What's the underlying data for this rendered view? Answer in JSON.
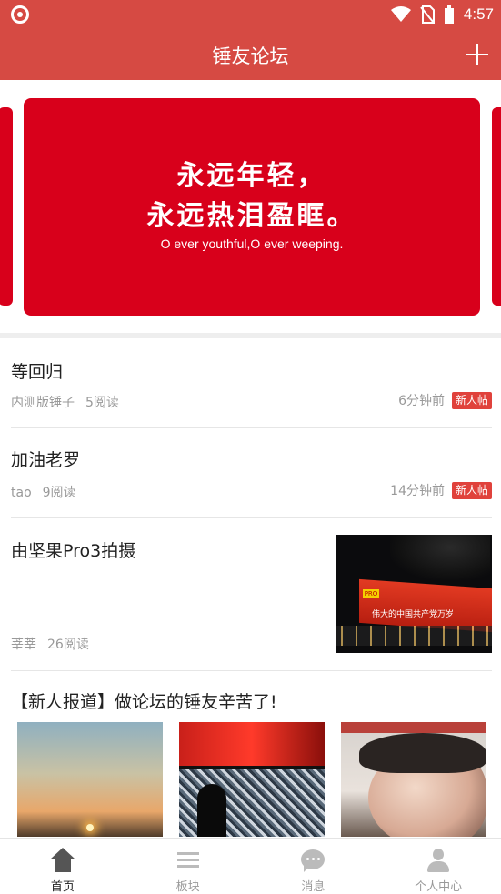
{
  "status_bar": {
    "time": "4:57",
    "icons": [
      "app-circle-icon",
      "wifi-icon",
      "no-sim-icon",
      "battery-icon"
    ]
  },
  "header": {
    "title": "锤友论坛",
    "add_icon": "plus-icon"
  },
  "banner": {
    "line1": "永远年轻，",
    "line2": "永远热泪盈眶。",
    "subtitle": "O ever youthful,O ever weeping."
  },
  "posts": [
    {
      "title": "等回归",
      "author": "内测版锤子",
      "reads": "5阅读",
      "time": "6分钟前",
      "badge": "新人帖"
    },
    {
      "title": "加油老罗",
      "author": "tao",
      "reads": "9阅读",
      "time": "14分钟前",
      "badge": "新人帖"
    },
    {
      "title": "由坚果Pro3拍摄",
      "author": "莘莘",
      "reads": "26阅读",
      "image_caption": "伟大的中国共产党万岁",
      "image_logo": "PRO"
    }
  ],
  "announcement": {
    "title": "【新人报道】做论坛的锤友辛苦了!"
  },
  "bottom_nav": {
    "items": [
      {
        "label": "首页",
        "icon": "home-icon",
        "active": true
      },
      {
        "label": "板块",
        "icon": "menu-icon",
        "active": false
      },
      {
        "label": "消息",
        "icon": "chat-icon",
        "active": false
      },
      {
        "label": "个人中心",
        "icon": "user-icon",
        "active": false
      }
    ]
  },
  "colors": {
    "header": "#d64a43",
    "banner": "#d8001b",
    "badge": "#e0423c"
  }
}
